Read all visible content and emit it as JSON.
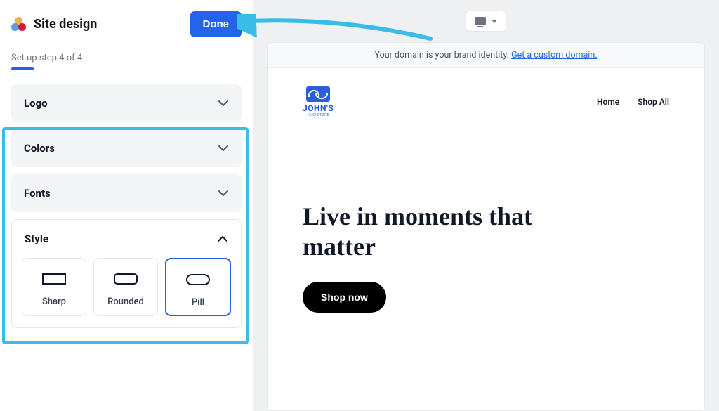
{
  "sidebar": {
    "title": "Site design",
    "done_label": "Done",
    "step_text": "Set up step 4 of 4"
  },
  "accordion": {
    "logo": {
      "label": "Logo"
    },
    "colors": {
      "label": "Colors"
    },
    "fonts": {
      "label": "Fonts"
    },
    "style": {
      "label": "Style",
      "options": [
        {
          "name": "Sharp"
        },
        {
          "name": "Rounded"
        },
        {
          "name": "Pill"
        }
      ],
      "selected": "Pill"
    }
  },
  "preview": {
    "domain_banner_text": "Your domain is your brand identity. ",
    "domain_banner_link": "Get a custom domain.",
    "site_name": "JOHN'S",
    "site_tagline": "FAKE STORE",
    "nav": {
      "home": "Home",
      "shop_all": "Shop All"
    },
    "hero_title": "Live in moments that matter",
    "shop_button": "Shop now"
  }
}
